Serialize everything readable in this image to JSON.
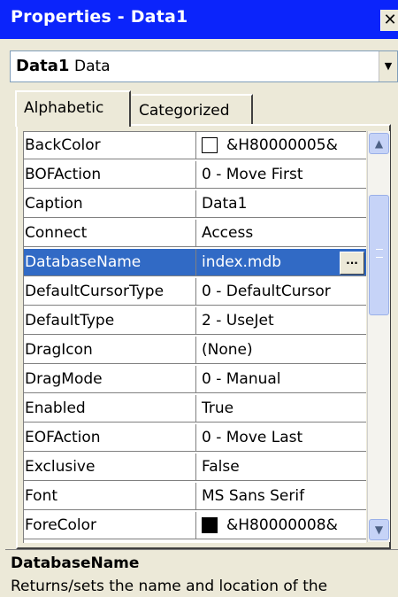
{
  "window": {
    "title": "Properties - Data1",
    "close_label": "✕"
  },
  "object_selector": {
    "name": "Data1",
    "type": "Data",
    "dropdown_icon": "▼"
  },
  "tabs": [
    {
      "label": "Alphabetic",
      "active": true
    },
    {
      "label": "Categorized",
      "active": false
    }
  ],
  "properties": [
    {
      "name": "BackColor",
      "value": "&H80000005&",
      "swatch": "#ffffff"
    },
    {
      "name": "BOFAction",
      "value": "0 - Move First"
    },
    {
      "name": "Caption",
      "value": "Data1"
    },
    {
      "name": "Connect",
      "value": "Access"
    },
    {
      "name": "DatabaseName",
      "value": "index.mdb",
      "selected": true,
      "button": "..."
    },
    {
      "name": "DefaultCursorType",
      "value": "0 - DefaultCursor"
    },
    {
      "name": "DefaultType",
      "value": "2 - UseJet"
    },
    {
      "name": "DragIcon",
      "value": "(None)"
    },
    {
      "name": "DragMode",
      "value": "0 - Manual"
    },
    {
      "name": "Enabled",
      "value": "True"
    },
    {
      "name": "EOFAction",
      "value": "0 - Move Last"
    },
    {
      "name": "Exclusive",
      "value": "False"
    },
    {
      "name": "Font",
      "value": "MS Sans Serif"
    },
    {
      "name": "ForeColor",
      "value": "&H80000008&",
      "swatch": "#000000"
    }
  ],
  "scrollbar": {
    "up_icon": "chevron-up-icon",
    "down_icon": "chevron-down-icon"
  },
  "description": {
    "title": "DatabaseName",
    "text": "Returns/sets the name and location of the"
  },
  "colors": {
    "titlebar": "#0b24fb",
    "selection": "#316ac5",
    "panel": "#ece9d8"
  }
}
